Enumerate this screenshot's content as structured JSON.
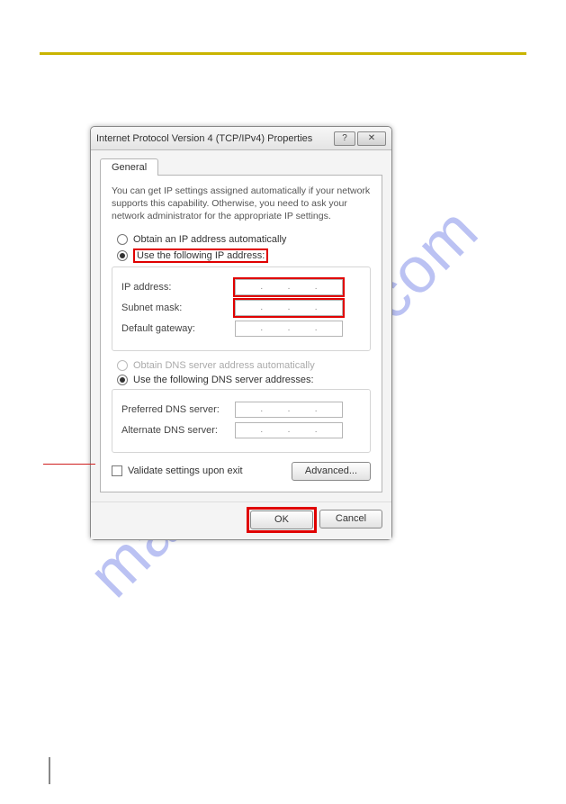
{
  "watermark": "manualshive.com",
  "dialog": {
    "title": "Internet Protocol Version 4 (TCP/IPv4) Properties",
    "help_btn": "?",
    "close_btn": "✕",
    "tab": "General",
    "intro": "You can get IP settings assigned automatically if your network supports this capability. Otherwise, you need to ask your network administrator for the appropriate IP settings.",
    "ip_section": {
      "auto_label": "Obtain an IP address automatically",
      "manual_label": "Use the following IP address:",
      "fields": {
        "ip": "IP address:",
        "mask": "Subnet mask:",
        "gw": "Default gateway:"
      }
    },
    "dns_section": {
      "auto_label": "Obtain DNS server address automatically",
      "manual_label": "Use the following DNS server addresses:",
      "fields": {
        "pref": "Preferred DNS server:",
        "alt": "Alternate DNS server:"
      }
    },
    "validate_label": "Validate settings upon exit",
    "advanced_btn": "Advanced...",
    "ok_btn": "OK",
    "cancel_btn": "Cancel"
  }
}
